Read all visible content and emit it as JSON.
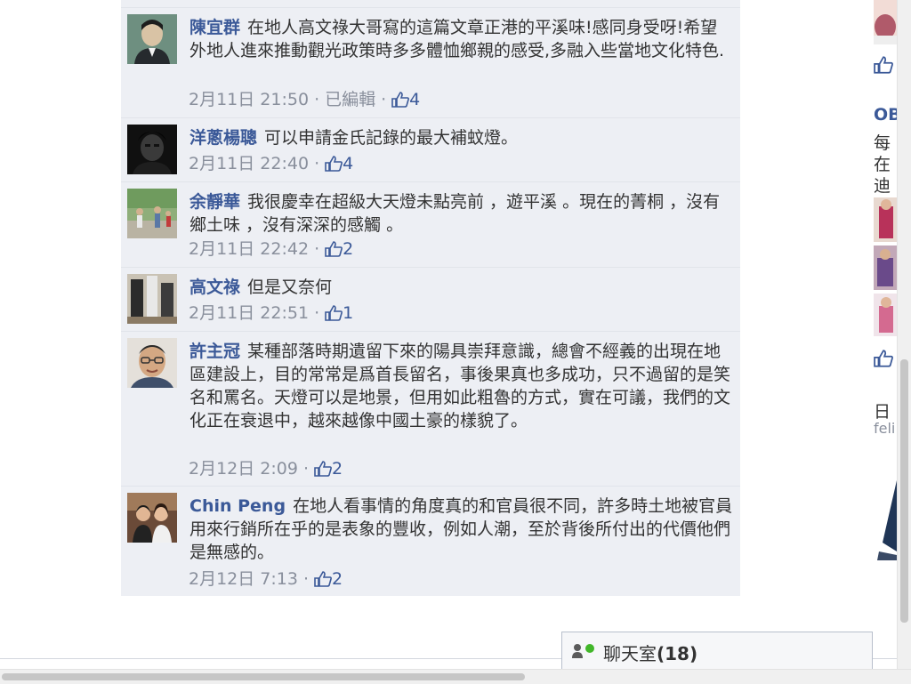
{
  "comments": [
    {
      "author": "陳宜群",
      "text": "在地人高文祿大哥寫的這篇文章正港的平溪味!感同身受呀!希望外地人進來推動觀光政策時多多體恤鄉親的感受,多融入些當地文化特色.",
      "time": "2月11日 21:50",
      "edited": "已編輯",
      "likes": "4"
    },
    {
      "author": "洋蔥楊聰",
      "text": "可以申請金氏記錄的最大補蚊燈。",
      "time": "2月11日 22:40",
      "likes": "4"
    },
    {
      "author": "余靜華",
      "text": "我很慶幸在超級大天燈未點亮前 ，遊平溪 。現在的菁桐 ，沒有鄉土味 ，沒有深深的感觸 。",
      "time": "2月11日 22:42",
      "likes": "2"
    },
    {
      "author": "高文祿",
      "text": "但是又奈何",
      "time": "2月11日 22:51",
      "likes": "1"
    },
    {
      "author": "許主冠",
      "text": "某種部落時期遺留下來的陽具崇拜意識，總會不經義的出現在地區建設上，目的常常是爲首長留名，事後果真也多成功，只不過留的是笑名和罵名。天燈可以是地景，但用如此粗魯的方式，實在可議，我們的文化正在衰退中，越來越像中國土豪的樣貌了。",
      "time": "2月12日 2:09",
      "likes": "2"
    },
    {
      "author": "Chin Peng",
      "text": "在地人看事情的角度真的和官員很不同，許多時土地被官員用來行銷所在乎的是表象的豐收，例如人潮，至於背後所付出的代價他們是無感的。",
      "time": "2月12日 7:13",
      "likes": "2"
    }
  ],
  "right_column": {
    "heading_partial": "OB",
    "lines_partial": [
      "每",
      "在",
      "迪"
    ],
    "bottom_partial": "日",
    "bottom_partial_2": "feli"
  },
  "chat": {
    "label": "聊天室",
    "count": "(18)"
  },
  "colors": {
    "link": "#3b5998",
    "panel": "#edeff4",
    "meta": "#898f9c"
  }
}
